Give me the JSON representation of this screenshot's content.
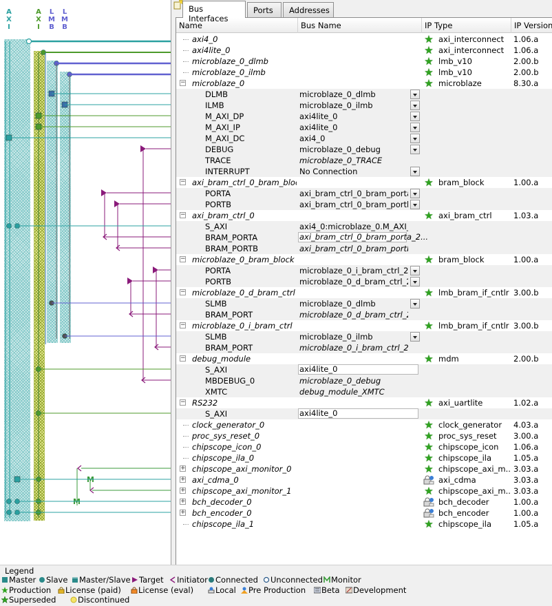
{
  "bus_headers": [
    {
      "name": "axi",
      "letters": [
        "A",
        "X",
        "I"
      ],
      "color": "#2aa0a0"
    },
    {
      "name": "axi-lite",
      "letters": [
        "A",
        "X",
        "I"
      ],
      "color": "#4c9a2a"
    },
    {
      "name": "lmb1",
      "letters": [
        "L",
        "M",
        "B"
      ],
      "color": "#6060d0"
    },
    {
      "name": "lmb2",
      "letters": [
        "L",
        "M",
        "B"
      ],
      "color": "#6060d0"
    }
  ],
  "tabs": [
    {
      "label": "Bus Interfaces",
      "active": true
    },
    {
      "label": "Ports",
      "active": false
    },
    {
      "label": "Addresses",
      "active": false
    }
  ],
  "columns": {
    "name": "Name",
    "bus": "Bus Name",
    "type": "IP Type",
    "version": "IP Version"
  },
  "rows": [
    {
      "kind": "ip",
      "name": "axi4_0",
      "type": "axi_interconnect",
      "version": "1.06.a",
      "icon": "production"
    },
    {
      "kind": "ip",
      "name": "axi4lite_0",
      "type": "axi_interconnect",
      "version": "1.06.a",
      "icon": "production"
    },
    {
      "kind": "ip",
      "name": "microblaze_0_dlmb",
      "type": "lmb_v10",
      "version": "2.00.b",
      "icon": "production"
    },
    {
      "kind": "ip",
      "name": "microblaze_0_ilmb",
      "type": "lmb_v10",
      "version": "2.00.b",
      "icon": "production"
    },
    {
      "kind": "ip",
      "name": "microblaze_0",
      "type": "microblaze",
      "version": "8.30.a",
      "icon": "production",
      "expander": "−"
    },
    {
      "kind": "if",
      "name": "DLMB",
      "bus": "microblaze_0_dlmb",
      "dropdown": true
    },
    {
      "kind": "if",
      "name": "ILMB",
      "bus": "microblaze_0_ilmb",
      "dropdown": true
    },
    {
      "kind": "if",
      "name": "M_AXI_DP",
      "bus": "axi4lite_0",
      "dropdown": true
    },
    {
      "kind": "if",
      "name": "M_AXI_IP",
      "bus": "axi4lite_0",
      "dropdown": true
    },
    {
      "kind": "if",
      "name": "M_AXI_DC",
      "bus": "axi4_0",
      "dropdown": true
    },
    {
      "kind": "if",
      "name": "DEBUG",
      "bus": "microblaze_0_debug",
      "dropdown": true
    },
    {
      "kind": "if",
      "name": "TRACE",
      "bus": "microblaze_0_TRACE",
      "busItalic": true
    },
    {
      "kind": "if",
      "name": "INTERRUPT",
      "bus": "No Connection",
      "dropdown": true
    },
    {
      "kind": "ip",
      "name": "axi_bram_ctrl_0_bram_block",
      "type": "bram_block",
      "version": "1.00.a",
      "icon": "production",
      "expander": "−"
    },
    {
      "kind": "if",
      "name": "PORTA",
      "bus": "axi_bram_ctrl_0_bram_porta...",
      "dropdown": true
    },
    {
      "kind": "if",
      "name": "PORTB",
      "bus": "axi_bram_ctrl_0_bram_portb...",
      "dropdown": true
    },
    {
      "kind": "ip",
      "name": "axi_bram_ctrl_0",
      "type": "axi_bram_ctrl",
      "version": "1.03.a",
      "icon": "production",
      "expander": "−"
    },
    {
      "kind": "if",
      "name": "S_AXI",
      "bus": "axi4_0:microblaze_0.M_AXI_DC..."
    },
    {
      "kind": "if",
      "name": "BRAM_PORTA",
      "bus": "axi_bram_ctrl_0_bram_porta_2...",
      "busItalic": true,
      "boxed": true
    },
    {
      "kind": "if",
      "name": "BRAM_PORTB",
      "bus": "axi_bram_ctrl_0_bram_portb_2...",
      "busItalic": true
    },
    {
      "kind": "ip",
      "name": "microblaze_0_bram_block",
      "type": "bram_block",
      "version": "1.00.a",
      "icon": "production",
      "expander": "−"
    },
    {
      "kind": "if",
      "name": "PORTA",
      "bus": "microblaze_0_i_bram_ctrl_2...",
      "dropdown": true
    },
    {
      "kind": "if",
      "name": "PORTB",
      "bus": "microblaze_0_d_bram_ctrl_2...",
      "dropdown": true
    },
    {
      "kind": "ip",
      "name": "microblaze_0_d_bram_ctrl",
      "type": "lmb_bram_if_cntlr",
      "version": "3.00.b",
      "icon": "production",
      "expander": "−"
    },
    {
      "kind": "if",
      "name": "SLMB",
      "bus": "microblaze_0_dlmb",
      "dropdown": true
    },
    {
      "kind": "if",
      "name": "BRAM_PORT",
      "bus": "microblaze_0_d_bram_ctrl_2_m...",
      "busItalic": true
    },
    {
      "kind": "ip",
      "name": "microblaze_0_i_bram_ctrl",
      "type": "lmb_bram_if_cntlr",
      "version": "3.00.b",
      "icon": "production",
      "expander": "−"
    },
    {
      "kind": "if",
      "name": "SLMB",
      "bus": "microblaze_0_ilmb",
      "dropdown": true
    },
    {
      "kind": "if",
      "name": "BRAM_PORT",
      "bus": "microblaze_0_i_bram_ctrl_2_mi...",
      "busItalic": true
    },
    {
      "kind": "ip",
      "name": "debug_module",
      "type": "mdm",
      "version": "2.00.b",
      "icon": "production",
      "expander": "−"
    },
    {
      "kind": "if",
      "name": "S_AXI",
      "bus": "axi4lite_0",
      "boxed": true,
      "wide": true
    },
    {
      "kind": "if",
      "name": "MBDEBUG_0",
      "bus": "microblaze_0_debug",
      "busItalic": true
    },
    {
      "kind": "if",
      "name": "XMTC",
      "bus": "debug_module_XMTC",
      "busItalic": true
    },
    {
      "kind": "ip",
      "name": "RS232",
      "type": "axi_uartlite",
      "version": "1.02.a",
      "icon": "production",
      "expander": "−"
    },
    {
      "kind": "if",
      "name": "S_AXI",
      "bus": "axi4lite_0",
      "boxed": true,
      "wide": true
    },
    {
      "kind": "ip",
      "name": "clock_generator_0",
      "type": "clock_generator",
      "version": "4.03.a",
      "icon": "production"
    },
    {
      "kind": "ip",
      "name": "proc_sys_reset_0",
      "type": "proc_sys_reset",
      "version": "3.00.a",
      "icon": "production"
    },
    {
      "kind": "ip",
      "name": "chipscope_icon_0",
      "type": "chipscope_icon",
      "version": "1.06.a",
      "icon": "production"
    },
    {
      "kind": "ip",
      "name": "chipscope_ila_0",
      "type": "chipscope_ila",
      "version": "1.05.a",
      "icon": "production"
    },
    {
      "kind": "ip",
      "name": "chipscope_axi_monitor_0",
      "type": "chipscope_axi_m...",
      "version": "3.03.a",
      "icon": "production",
      "expander": "+"
    },
    {
      "kind": "ip",
      "name": "axi_cdma_0",
      "type": "axi_cdma",
      "version": "3.03.a",
      "icon": "eval",
      "expander": "+"
    },
    {
      "kind": "ip",
      "name": "chipscope_axi_monitor_1",
      "type": "chipscope_axi_m...",
      "version": "3.03.a",
      "icon": "production",
      "expander": "+"
    },
    {
      "kind": "ip",
      "name": "bch_decoder_0",
      "type": "bch_decoder",
      "version": "1.00.a",
      "icon": "eval",
      "expander": "+"
    },
    {
      "kind": "ip",
      "name": "bch_encoder_0",
      "type": "bch_encoder",
      "version": "1.00.a",
      "icon": "eval",
      "expander": "+"
    },
    {
      "kind": "ip",
      "name": "chipscope_ila_1",
      "type": "chipscope_ila",
      "version": "1.05.a",
      "icon": "production"
    }
  ],
  "legend": {
    "title": "Legend",
    "items": [
      {
        "label": "Master",
        "icon": "square-teal"
      },
      {
        "label": "Slave",
        "icon": "circle-teal"
      },
      {
        "label": "Master/Slave",
        "icon": "half-square-teal"
      },
      {
        "label": "Target",
        "icon": "triangle-purple"
      },
      {
        "label": "Initiator",
        "icon": "chevron-purple"
      },
      {
        "label": "Connected",
        "icon": "circle-filled"
      },
      {
        "label": "Unconnected",
        "icon": "circle-hollow"
      },
      {
        "label": "Monitor",
        "icon": "m-green"
      },
      {
        "label": "Production",
        "icon": "star-green"
      },
      {
        "label": "License (paid)",
        "icon": "lock-gold"
      },
      {
        "label": "License (eval)",
        "icon": "lock-orange"
      },
      {
        "label": "Local",
        "icon": "local-blue"
      },
      {
        "label": "Pre Production",
        "icon": "person-blue"
      },
      {
        "label": "Beta",
        "icon": "beta-gray"
      },
      {
        "label": "Development",
        "icon": "dev-gray"
      },
      {
        "label": "Superseded",
        "icon": "star-half"
      },
      {
        "label": "Discontinued",
        "icon": "circle-yellow"
      }
    ]
  },
  "colors": {
    "axi": "#2aa0a0",
    "axilite": "#4c9a2a",
    "lmb": "#6060d0",
    "target": "#8a1a7a",
    "monitor": "#3a9a3a"
  }
}
